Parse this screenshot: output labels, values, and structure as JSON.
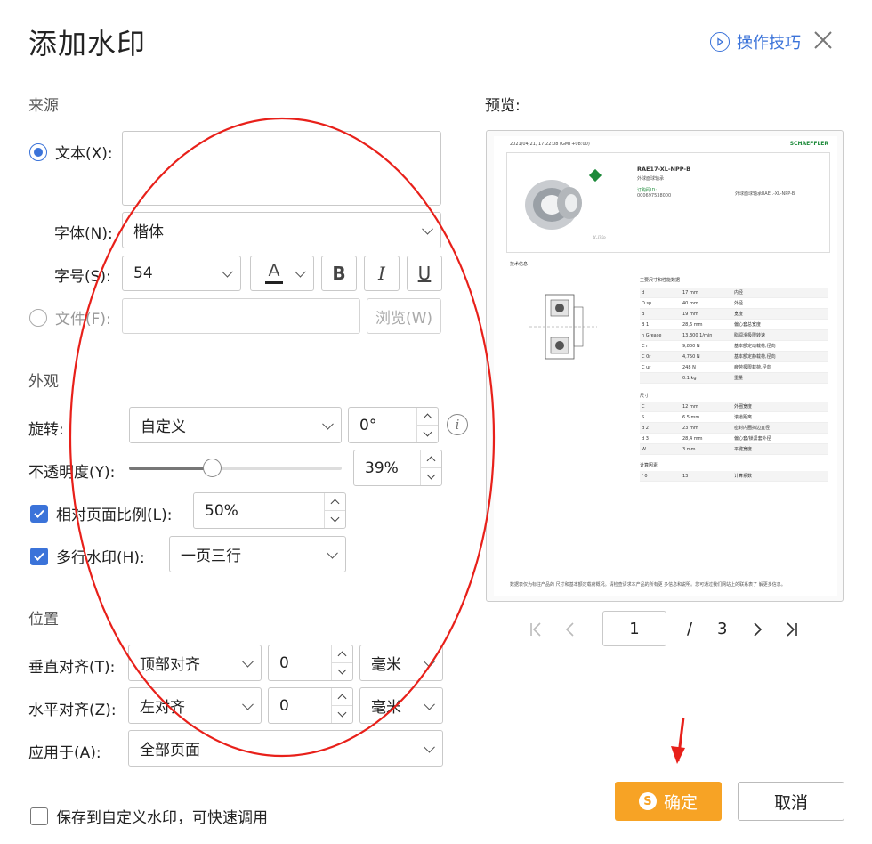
{
  "dialog": {
    "title": "添加水印",
    "tips_label": "操作技巧"
  },
  "source": {
    "section": "来源",
    "text_label": "文本(X):",
    "text_value": "",
    "font_label": "字体(N):",
    "font_value": "楷体",
    "size_label": "字号(S):",
    "size_value": "54",
    "color_glyph": "A",
    "bold": "B",
    "italic": "I",
    "underline": "U",
    "file_label": "文件(F):",
    "file_value": "",
    "browse": "浏览(W)"
  },
  "appearance": {
    "section": "外观",
    "rotate_label": "旋转:",
    "rotate_mode": "自定义",
    "rotate_value": "0°",
    "opacity_label": "不透明度(Y):",
    "opacity_value": "39%",
    "opacity_fraction": 0.39,
    "relative_label": "相对页面比例(L):",
    "relative_value": "50%",
    "multiline_label": "多行水印(H):",
    "multiline_value": "一页三行"
  },
  "position": {
    "section": "位置",
    "valign_label": "垂直对齐(T):",
    "valign_value": "顶部对齐",
    "valign_offset": "0",
    "valign_unit": "毫米",
    "halign_label": "水平对齐(Z):",
    "halign_value": "左对齐",
    "halign_offset": "0",
    "halign_unit": "毫米",
    "apply_label": "应用于(A):",
    "apply_value": "全部页面"
  },
  "save_custom_label": "保存到自定义水印，可快速调用",
  "preview": {
    "label": "预览:",
    "doc": {
      "timestamp": "2021/04/21, 17:22:08 (GMT+08:00)",
      "brand": "SCHAEFFLER",
      "product": "RAE17-XL-NPP-B",
      "subtitle": "外球面球轴承",
      "order_label": "订购码ID:",
      "order_id": "000697538000",
      "desc": "外球面球轴承RAE..-XL-NPP-B",
      "xlife": "X-life",
      "tech_info": "技术信息",
      "main_dims": "主要尺寸和性能数据",
      "rows1": [
        [
          "d",
          "17 mm",
          "内径"
        ],
        [
          "D sp",
          "40 mm",
          "外径"
        ],
        [
          "B",
          "19 mm",
          "宽度"
        ],
        [
          "B 1",
          "28,6 mm",
          "偏心套总宽度"
        ],
        [
          "n Grease",
          "13,300 1/min",
          "脂润滑极限转速"
        ],
        [
          "C r",
          "9,800 N",
          "基本额定动载荷,径向"
        ],
        [
          "C 0r",
          "4,750 N",
          "基本额定静载荷,径向"
        ],
        [
          "C ur",
          "248 N",
          "疲劳极限载荷,径向"
        ],
        [
          "",
          "0.1 kg",
          "重量"
        ]
      ],
      "dims_title": "尺寸",
      "rows2": [
        [
          "C",
          "12 mm",
          "外圈宽度"
        ],
        [
          "S",
          "6.5 mm",
          "滚道距离"
        ],
        [
          "d 2",
          "23 mm",
          "密封内圈挡边直径"
        ],
        [
          "d 3",
          "28,4 mm",
          "偏心套/锁紧套外径"
        ],
        [
          "W",
          "3 mm",
          "平键宽度"
        ]
      ],
      "calc_title": "计算因素",
      "rows3": [
        [
          "f 0",
          "13",
          "计算系数"
        ]
      ],
      "footer": "数据表仅为标注产品的 尺寸和基本额定载荷概况。请检查请求本产品的所有更 多信息和说明。您可通过我们网站上的联系表了 解更多信息。"
    }
  },
  "pager": {
    "current": "1",
    "separator": "/",
    "total": "3"
  },
  "buttons": {
    "ok": "确定",
    "cancel": "取消"
  },
  "colors": {
    "accent": "#3b73d9",
    "ok_button": "#f7a325",
    "annotation": "#e8201a"
  }
}
